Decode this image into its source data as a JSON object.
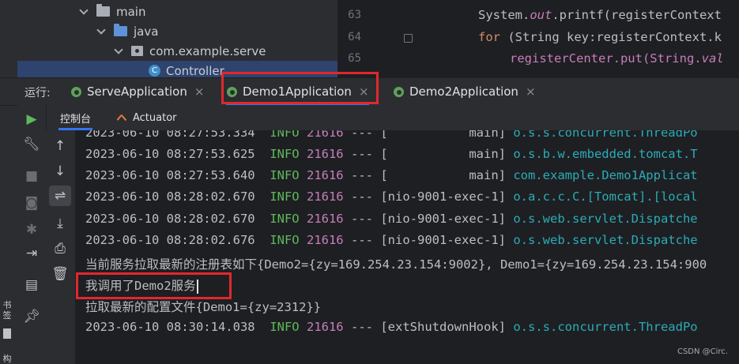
{
  "project_tree": {
    "items": [
      {
        "label": "main",
        "icon": "folder-icon"
      },
      {
        "label": "java",
        "icon": "source-folder-icon"
      },
      {
        "label": "com.example.serve",
        "icon": "package-icon"
      },
      {
        "label": "Controller",
        "icon": "class-icon",
        "badge": "C"
      }
    ]
  },
  "editor": {
    "lines": [
      {
        "number": "63",
        "code_pre": "System.",
        "code_italic": "out",
        "code_post": ".printf(registerContext"
      },
      {
        "number": "64",
        "keyword": "for",
        "code_post": " (String key:registerContext.k"
      },
      {
        "number": "65",
        "code_pre": "registerCenter.put(String.",
        "code_italic": "val"
      }
    ]
  },
  "run_bar": {
    "label": "运行:",
    "tabs": [
      {
        "label": "ServeApplication",
        "close": "×"
      },
      {
        "label": "Demo1Application",
        "close": "×"
      },
      {
        "label": "Demo2Application",
        "close": "×"
      }
    ]
  },
  "console_tabs": [
    {
      "label": "控制台"
    },
    {
      "label": "Actuator"
    }
  ],
  "side_stripe": {
    "text_a": "书签",
    "text_b": "构"
  },
  "console": {
    "lines": [
      {
        "ts": "2023-06-10 08:27:53.334",
        "level": "INFO",
        "pid": "21616",
        "sep": "---",
        "thread": "[           main]",
        "logger": "o.s.s.concurrent.ThreadPo"
      },
      {
        "ts": "2023-06-10 08:27:53.625",
        "level": "INFO",
        "pid": "21616",
        "sep": "---",
        "thread": "[           main]",
        "logger": "o.s.b.w.embedded.tomcat.T"
      },
      {
        "ts": "2023-06-10 08:27:53.640",
        "level": "INFO",
        "pid": "21616",
        "sep": "---",
        "thread": "[           main]",
        "logger": "com.example.Demo1Applicat"
      },
      {
        "ts": "2023-06-10 08:28:02.670",
        "level": "INFO",
        "pid": "21616",
        "sep": "---",
        "thread": "[nio-9001-exec-1]",
        "logger": "o.a.c.c.C.[Tomcat].[local"
      },
      {
        "ts": "2023-06-10 08:28:02.670",
        "level": "INFO",
        "pid": "21616",
        "sep": "---",
        "thread": "[nio-9001-exec-1]",
        "logger": "o.s.web.servlet.Dispatche"
      },
      {
        "ts": "2023-06-10 08:28:02.676",
        "level": "INFO",
        "pid": "21616",
        "sep": "---",
        "thread": "[nio-9001-exec-1]",
        "logger": "o.s.web.servlet.Dispatche"
      }
    ],
    "plain_1": "当前服务拉取最新的注册表如下{Demo2={zy=169.254.23.154:9002}, Demo1={zy=169.254.23.154:900",
    "plain_2": "我调用了Demo2服务",
    "plain_3": "拉取最新的配置文件{Demo1={zy=2312}}",
    "last_line": {
      "ts": "2023-06-10 08:30:14.038",
      "level": "INFO",
      "pid": "21616",
      "sep": "---",
      "thread": "[extShutdownHook]",
      "logger": "o.s.s.concurrent.ThreadPo"
    }
  },
  "watermark": "CSDN @Circ.",
  "colors": {
    "highlight_box": "#e1282e",
    "accent": "#3574f0",
    "info": "#5fb85c",
    "pid": "#c77dbb",
    "logger": "#2aacb8"
  }
}
